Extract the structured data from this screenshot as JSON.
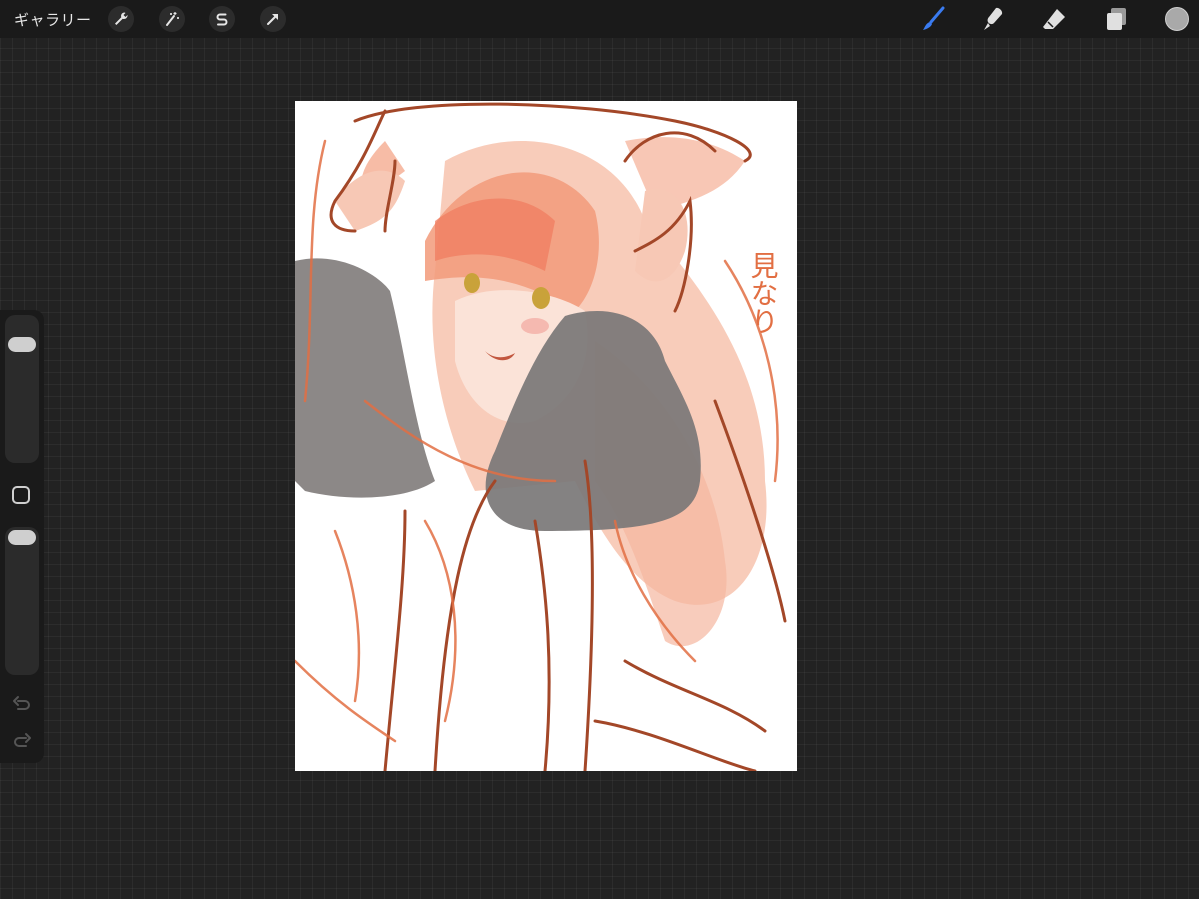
{
  "toolbar": {
    "gallery_label": "ギャラリー",
    "left_tools": [
      "wrench-icon",
      "magic-wand-icon",
      "selection-s-icon",
      "transform-arrow-icon"
    ],
    "right_tools": [
      "brush-icon",
      "smudge-icon",
      "eraser-icon",
      "layers-icon"
    ],
    "active_tool": "brush",
    "accent_color": "#3a7bf0",
    "current_color": "#a9a9a9"
  },
  "sidebar": {
    "brush_size_level": 0.85,
    "opacity_level": 1.0,
    "buttons": [
      "modify-square-icon",
      "undo-icon",
      "redo-icon"
    ]
  },
  "canvas": {
    "handwritten_text": "見なり"
  }
}
